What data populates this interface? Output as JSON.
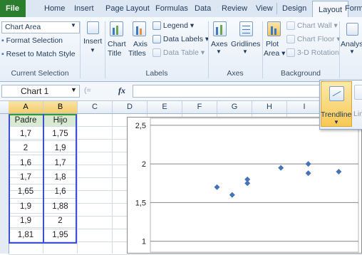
{
  "tabs": [
    {
      "label": "File"
    },
    {
      "label": "Home"
    },
    {
      "label": "Insert"
    },
    {
      "label": "Page Layout"
    },
    {
      "label": "Formulas"
    },
    {
      "label": "Data"
    },
    {
      "label": "Review"
    },
    {
      "label": "View"
    },
    {
      "label": "Design"
    },
    {
      "label": "Layout"
    },
    {
      "label": "Format"
    }
  ],
  "active_tab": "Layout",
  "ribbon": {
    "current_selection": {
      "dropdown_value": "Chart Area",
      "format_selection": "Format Selection",
      "reset_style": "Reset to Match Style",
      "group_label": "Current Selection"
    },
    "insert": {
      "label": "Insert"
    },
    "labels": {
      "chart_title": "Chart",
      "chart_title2": "Title",
      "axis_titles": "Axis",
      "axis_titles2": "Titles",
      "legend": "Legend",
      "data_labels": "Data Labels",
      "data_table": "Data Table",
      "group_label": "Labels"
    },
    "axes": {
      "axes": "Axes",
      "gridlines": "Gridlines",
      "group_label": "Axes"
    },
    "background": {
      "plot_area": "Plot",
      "plot_area2": "Area",
      "chart_wall": "Chart Wall",
      "chart_floor": "Chart Floor",
      "rotation": "3-D Rotation",
      "group_label": "Background"
    },
    "analysis": {
      "label": "Analysis"
    }
  },
  "formula_bar": {
    "name_box": "Chart 1",
    "fx": "fx",
    "value": ""
  },
  "columns": [
    "A",
    "B",
    "C",
    "D",
    "E",
    "F",
    "G",
    "H",
    "I"
  ],
  "table": {
    "headers": [
      "Padre",
      "Hijo"
    ],
    "rows": [
      [
        "1,7",
        "1,75"
      ],
      [
        "2",
        "1,9"
      ],
      [
        "1,6",
        "1,7"
      ],
      [
        "1,7",
        "1,8"
      ],
      [
        "1,65",
        "1,6"
      ],
      [
        "1,9",
        "1,88"
      ],
      [
        "1,9",
        "2"
      ],
      [
        "1,81",
        "1,95"
      ]
    ]
  },
  "popup": {
    "trendline": "Trendline",
    "lines": "Lin"
  },
  "chart_data": {
    "type": "scatter",
    "y_ticks": [
      "2,5",
      "2",
      "1,5",
      "1"
    ],
    "ylim": [
      0.85,
      2.6
    ],
    "xlim": [
      1.4,
      2.06
    ],
    "grid": true,
    "series": [
      {
        "points": [
          {
            "x": 1.7,
            "y": 1.75
          },
          {
            "x": 2.0,
            "y": 1.9
          },
          {
            "x": 1.6,
            "y": 1.7
          },
          {
            "x": 1.7,
            "y": 1.8
          },
          {
            "x": 1.65,
            "y": 1.6
          },
          {
            "x": 1.9,
            "y": 1.88
          },
          {
            "x": 1.9,
            "y": 2.0
          },
          {
            "x": 1.81,
            "y": 1.95
          }
        ],
        "color": "#4573b8"
      }
    ]
  }
}
